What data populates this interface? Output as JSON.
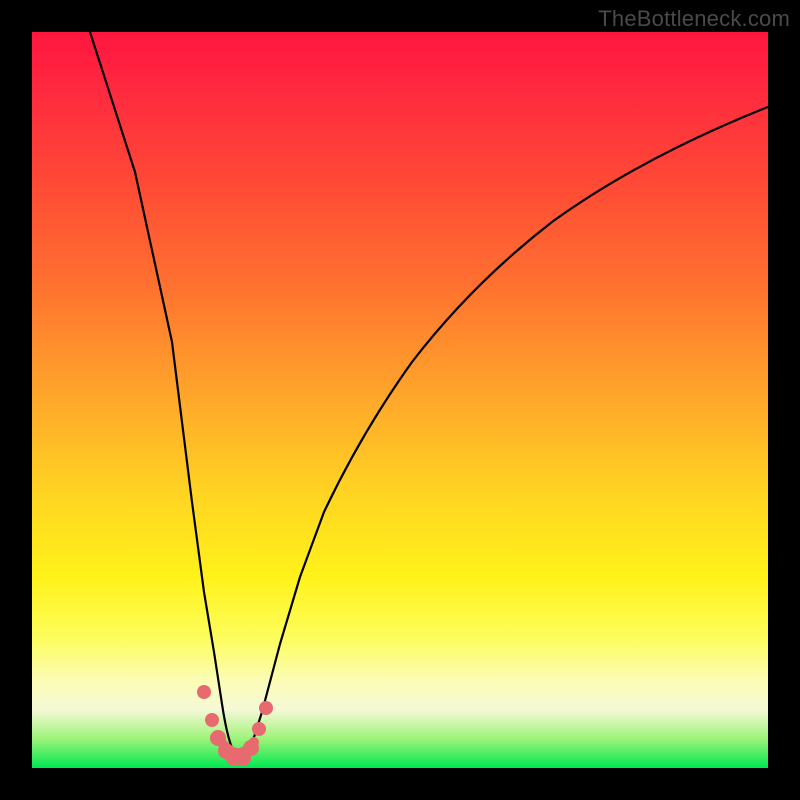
{
  "watermark": "TheBottleneck.com",
  "chart_data": {
    "type": "line",
    "title": "",
    "xlabel": "",
    "ylabel": "",
    "xlim": [
      0,
      100
    ],
    "ylim": [
      0,
      100
    ],
    "series": [
      {
        "name": "bottleneck-curve",
        "x": [
          8,
          10,
          12,
          14,
          16,
          18,
          20,
          22,
          23,
          24,
          25,
          26,
          27,
          28,
          29,
          30,
          32,
          34,
          36,
          38,
          40,
          44,
          50,
          58,
          66,
          76,
          88,
          100
        ],
        "values": [
          100,
          90,
          79,
          69,
          59,
          48,
          37,
          24,
          17,
          12,
          8,
          4,
          2,
          1,
          2,
          6,
          14,
          22,
          29,
          35,
          41,
          50,
          60,
          69,
          76,
          82,
          87,
          90
        ]
      }
    ],
    "markers": {
      "name": "highlight-dots",
      "x": [
        22.5,
        23.5,
        24.5,
        25.5,
        26.5,
        27.5,
        28.5,
        29.5,
        30.2
      ],
      "values": [
        9,
        5,
        3,
        1.8,
        1.2,
        1.2,
        2.5,
        5,
        8
      ]
    },
    "gradient_stops": [
      {
        "pos": 0,
        "color": "#ff163f"
      },
      {
        "pos": 8,
        "color": "#ff2a3f"
      },
      {
        "pos": 20,
        "color": "#ff4836"
      },
      {
        "pos": 34,
        "color": "#ff7030"
      },
      {
        "pos": 50,
        "color": "#ffa82a"
      },
      {
        "pos": 63,
        "color": "#ffd522"
      },
      {
        "pos": 74,
        "color": "#fff21a"
      },
      {
        "pos": 82,
        "color": "#fdfd5a"
      },
      {
        "pos": 88,
        "color": "#fcfcb4"
      },
      {
        "pos": 92,
        "color": "#f6f9d6"
      },
      {
        "pos": 96,
        "color": "#9ff37a"
      },
      {
        "pos": 100,
        "color": "#00e852"
      }
    ],
    "grid": false,
    "legend": false
  }
}
